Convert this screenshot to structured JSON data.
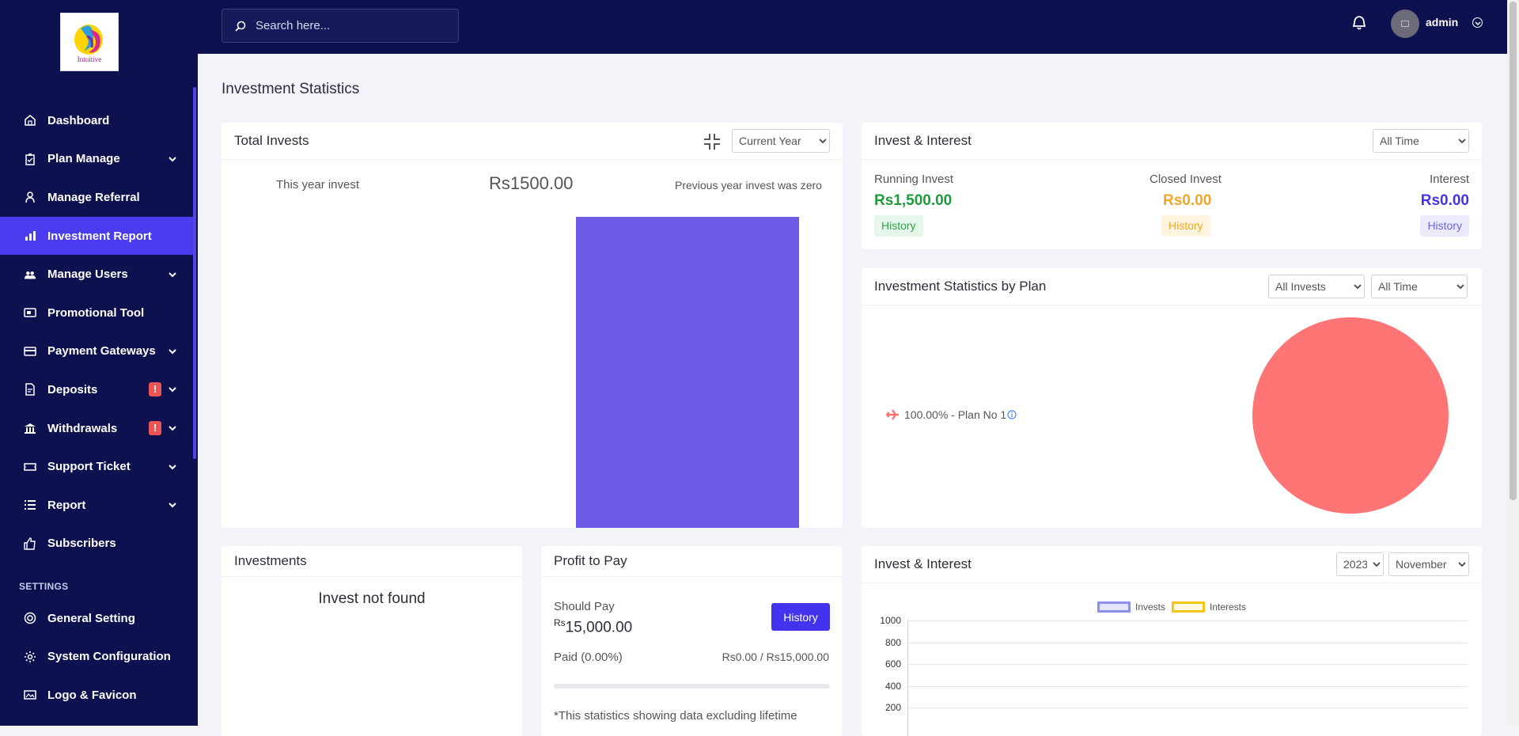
{
  "sidebar": {
    "brand": "Intuitive",
    "items": [
      {
        "label": "Dashboard",
        "icon": "home-icon",
        "has_chevron": false
      },
      {
        "label": "Plan Manage",
        "icon": "clipboard-icon",
        "has_chevron": true
      },
      {
        "label": "Manage Referral",
        "icon": "referral-icon",
        "has_chevron": false
      },
      {
        "label": "Investment Report",
        "icon": "bar-chart-icon",
        "has_chevron": false,
        "active": true
      },
      {
        "label": "Manage Users",
        "icon": "users-icon",
        "has_chevron": true
      },
      {
        "label": "Promotional Tool",
        "icon": "ad-icon",
        "has_chevron": false
      },
      {
        "label": "Payment Gateways",
        "icon": "credit-card-icon",
        "has_chevron": true
      },
      {
        "label": "Deposits",
        "icon": "deposit-icon",
        "has_chevron": true,
        "alert": "!"
      },
      {
        "label": "Withdrawals",
        "icon": "bank-icon",
        "has_chevron": true,
        "alert": "!"
      },
      {
        "label": "Support Ticket",
        "icon": "ticket-icon",
        "has_chevron": true
      },
      {
        "label": "Report",
        "icon": "list-icon",
        "has_chevron": true
      },
      {
        "label": "Subscribers",
        "icon": "thumbs-up-icon",
        "has_chevron": false
      }
    ],
    "settings_heading": "SETTINGS",
    "settings_items": [
      {
        "label": "General Setting",
        "icon": "life-ring-icon"
      },
      {
        "label": "System Configuration",
        "icon": "gear-icon"
      },
      {
        "label": "Logo & Favicon",
        "icon": "image-icon"
      }
    ]
  },
  "topbar": {
    "search_placeholder": "Search here...",
    "username": "admin"
  },
  "page": {
    "title": "Investment Statistics"
  },
  "total_invests": {
    "title": "Total Invests",
    "period_select": "Current Year",
    "this_year_label": "This year invest",
    "amount": "Rs1500.00",
    "previous_note": "Previous year invest was zero"
  },
  "invest_interest": {
    "title": "Invest & Interest",
    "period_select": "All Time",
    "running_label": "Running Invest",
    "running_value": "Rs1,500.00",
    "closed_label": "Closed Invest",
    "closed_value": "Rs0.00",
    "interest_label": "Interest",
    "interest_value": "Rs0.00",
    "history_label": "History"
  },
  "by_plan": {
    "title": "Investment Statistics by Plan",
    "filter_select": "All Invests",
    "period_select": "All Time",
    "legend": "100.00% - Plan No 1"
  },
  "investments": {
    "title": "Investments",
    "empty_text": "Invest not found"
  },
  "profit_to_pay": {
    "title": "Profit to Pay",
    "should_pay_label": "Should Pay",
    "currency": "Rs",
    "amount": "15,000.00",
    "history_button": "History",
    "paid_label": "Paid (0.00%)",
    "paid_value": "Rs0.00 / Rs15,000.00",
    "note": "*This statistics showing data excluding lifetime"
  },
  "monthly_chart": {
    "title": "Invest & Interest",
    "year_select": "2023",
    "month_select": "November",
    "legend_invests": "Invests",
    "legend_interests": "Interests",
    "y_ticks": [
      "1000",
      "800",
      "600",
      "400",
      "200"
    ]
  },
  "colors": {
    "sidebar_bg": "#0d1150",
    "accent": "#4c3cf0",
    "bar": "#6c5ce7",
    "pie": "#ff7474",
    "success": "#28a745",
    "warning": "#f5a623",
    "primary": "#4433ee"
  }
}
